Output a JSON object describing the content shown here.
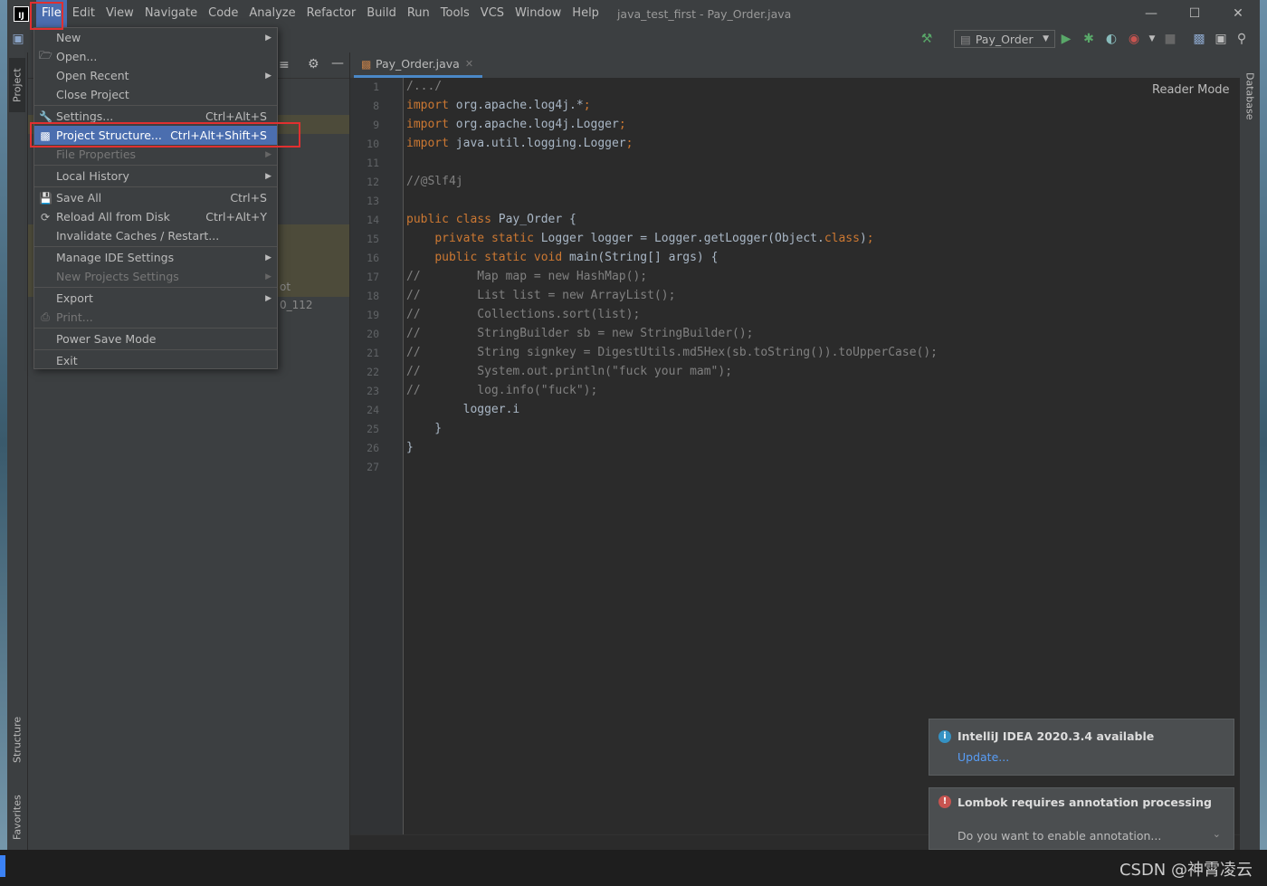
{
  "menubar": {
    "items": [
      "File",
      "Edit",
      "View",
      "Navigate",
      "Code",
      "Analyze",
      "Refactor",
      "Build",
      "Run",
      "Tools",
      "VCS",
      "Window",
      "Help"
    ],
    "window_title": "java_test_first - Pay_Order.java"
  },
  "toolbar": {
    "run_config": "Pay_Order"
  },
  "left_tabs": {
    "project": "Project",
    "structure": "Structure",
    "favorites": "Favorites"
  },
  "right_tabs": {
    "database": "Database"
  },
  "project_panel": {
    "partial_1": "ot",
    "partial_2": "0_112"
  },
  "file_menu": {
    "new": "New",
    "open": "Open...",
    "open_recent": "Open Recent",
    "close_project": "Close Project",
    "settings": "Settings...",
    "settings_sc": "Ctrl+Alt+S",
    "project_structure": "Project Structure...",
    "project_structure_sc": "Ctrl+Alt+Shift+S",
    "file_properties": "File Properties",
    "local_history": "Local History",
    "save_all": "Save All",
    "save_all_sc": "Ctrl+S",
    "reload": "Reload All from Disk",
    "reload_sc": "Ctrl+Alt+Y",
    "invalidate": "Invalidate Caches / Restart...",
    "manage_ide": "Manage IDE Settings",
    "new_projects": "New Projects Settings",
    "export": "Export",
    "print": "Print...",
    "power_save": "Power Save Mode",
    "exit": "Exit"
  },
  "editor": {
    "tab": "Pay_Order.java",
    "reader_mode": "Reader Mode",
    "lines": [
      {
        "no": "1",
        "text": "/.../"
      },
      {
        "no": "8",
        "text": "import org.apache.log4j.*;"
      },
      {
        "no": "9",
        "text": "import org.apache.log4j.Logger;"
      },
      {
        "no": "10",
        "text": "import java.util.logging.Logger;"
      },
      {
        "no": "11",
        "text": ""
      },
      {
        "no": "12",
        "text": "//@Slf4j"
      },
      {
        "no": "13",
        "text": ""
      },
      {
        "no": "14",
        "text": "public class Pay_Order {"
      },
      {
        "no": "15",
        "text": "    private static Logger logger = Logger.getLogger(Object.class);"
      },
      {
        "no": "16",
        "text": "    public static void main(String[] args) {"
      },
      {
        "no": "17",
        "text": "//        Map map = new HashMap();"
      },
      {
        "no": "18",
        "text": "//        List list = new ArrayList();"
      },
      {
        "no": "19",
        "text": "//        Collections.sort(list);"
      },
      {
        "no": "20",
        "text": "//        StringBuilder sb = new StringBuilder();"
      },
      {
        "no": "21",
        "text": "//        String signkey = DigestUtils.md5Hex(sb.toString()).toUpperCase();"
      },
      {
        "no": "22",
        "text": "//        System.out.println(\"fuck your mam\");"
      },
      {
        "no": "23",
        "text": "//        log.info(\"fuck\");"
      },
      {
        "no": "24",
        "text": "        logger.i"
      },
      {
        "no": "25",
        "text": "    }"
      },
      {
        "no": "26",
        "text": "}"
      },
      {
        "no": "27",
        "text": ""
      }
    ]
  },
  "notifications": {
    "update_title": "IntelliJ IDEA 2020.3.4 available",
    "update_link": "Update...",
    "lombok_title": "Lombok requires annotation processing",
    "lombok_body": "Do you want to enable annotation..."
  },
  "watermark": "CSDN @神霄凌云",
  "colors": {
    "accent": "#4b6eaf",
    "highlight": "#e03030",
    "keyword": "#cc7832",
    "comment": "#808080"
  }
}
